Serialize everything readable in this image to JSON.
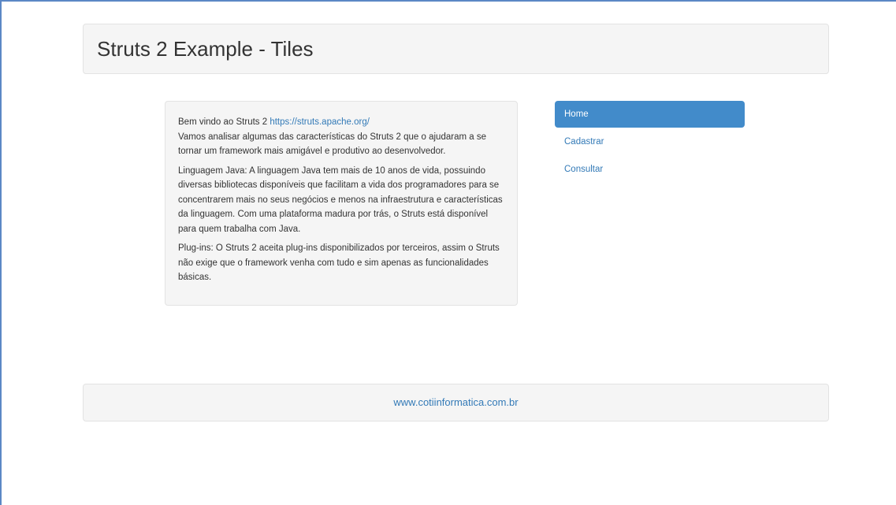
{
  "header": {
    "title": "Struts 2 Example - Tiles"
  },
  "content": {
    "welcome_text": "Bem vindo ao Struts 2 ",
    "welcome_link": "https://struts.apache.org/",
    "intro": "Vamos analisar algumas das características do Struts 2 que o ajudaram a se tornar um framework mais amigável e produtivo ao desenvolvedor.",
    "paragraph_java": "Linguagem Java: A linguagem Java tem mais de 10 anos de vida, possuindo diversas bibliotecas disponíveis que facilitam a vida dos programadores para se concentrarem mais no seus negócios e menos na infraestrutura e características da linguagem. Com uma plataforma madura por trás, o Struts está disponível para quem trabalha com Java.",
    "paragraph_plugins": "Plug-ins: O Struts 2 aceita plug-ins disponibilizados por terceiros, assim o Struts não exige que o framework venha com tudo e sim apenas as funcionalidades básicas."
  },
  "nav": {
    "items": [
      {
        "label": "Home",
        "active": true
      },
      {
        "label": "Cadastrar",
        "active": false
      },
      {
        "label": "Consultar",
        "active": false
      }
    ]
  },
  "footer": {
    "link": "www.cotiinformatica.com.br"
  },
  "colors": {
    "accent": "#428bca",
    "link": "#337ab7",
    "well_background": "#f5f5f5"
  }
}
